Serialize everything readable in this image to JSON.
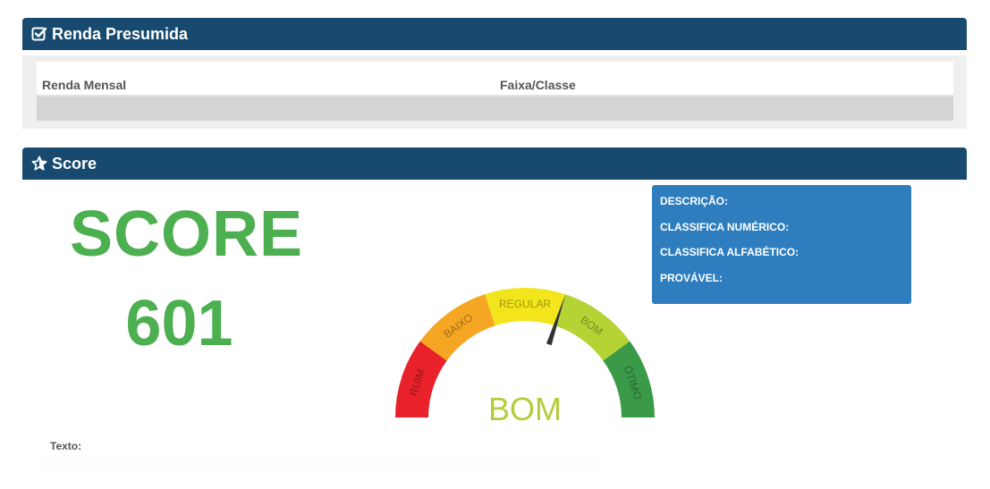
{
  "renda_presumida": {
    "title": "Renda Presumida",
    "icon": "check-square-icon",
    "columns": [
      "Renda Mensal",
      "Faixa/Classe"
    ],
    "rows": [
      [
        "",
        ""
      ]
    ]
  },
  "score": {
    "title": "Score",
    "icon": "star-icon",
    "headline": "SCORE",
    "value": "601",
    "text_label": "Texto:",
    "text_value": "",
    "accent_color": "#4caf50"
  },
  "info": {
    "descricao_label": "DESCRIÇÃO:",
    "classifica_numerico_label": "CLASSIFICA NUMÉRICO:",
    "classifica_alfabetico_label": "CLASSIFICA ALFABÉTICO:",
    "provavel_label": "PROVÁVEL:",
    "box_color": "#2e7ebf"
  },
  "gauge": {
    "min": 0,
    "max": 1000,
    "value": 601,
    "current_label": "BOM",
    "current_label_color": "#b5cc3a",
    "segments": [
      {
        "label": "RUIM",
        "color": "#e8212a"
      },
      {
        "label": "BAIXO",
        "color": "#f5a623"
      },
      {
        "label": "REGULAR",
        "color": "#f2e51b"
      },
      {
        "label": "BOM",
        "color": "#b5d334"
      },
      {
        "label": "ÓTIMO",
        "color": "#3a9a48"
      }
    ]
  },
  "theme": {
    "header_color": "#174a6e"
  }
}
